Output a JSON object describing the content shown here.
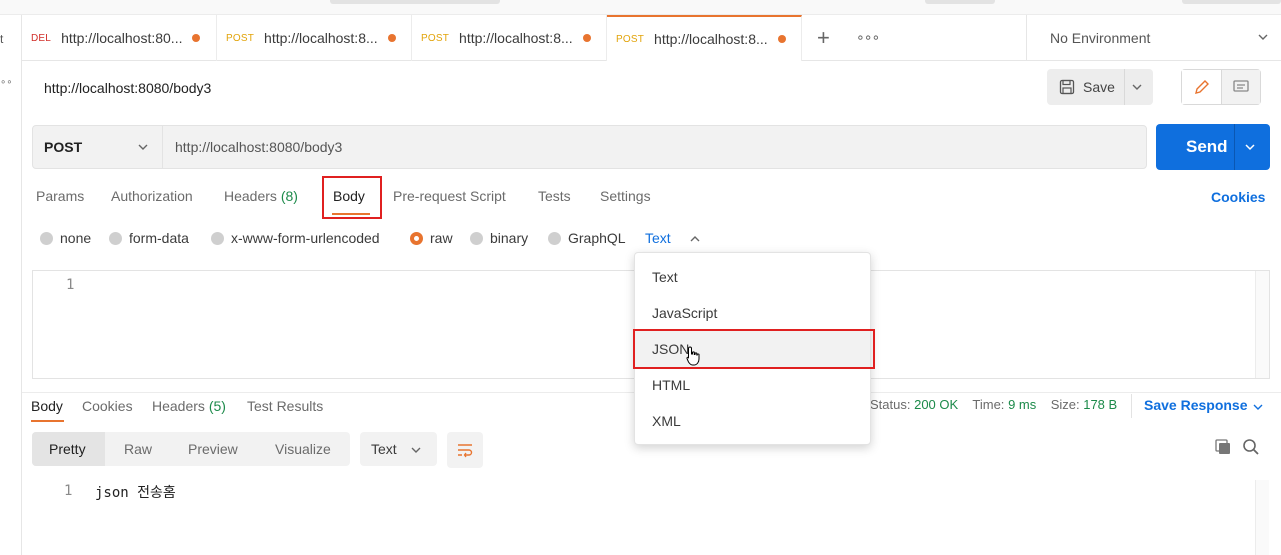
{
  "tabs": [
    {
      "method": "DEL",
      "url": "http://localhost:80..."
    },
    {
      "method": "POST",
      "url": "http://localhost:8..."
    },
    {
      "method": "POST",
      "url": "http://localhost:8..."
    },
    {
      "method": "POST",
      "url": "http://localhost:8..."
    }
  ],
  "environment": "No Environment",
  "request": {
    "name": "http://localhost:8080/body3",
    "save_label": "Save",
    "method": "POST",
    "url": "http://localhost:8080/body3",
    "send_label": "Send"
  },
  "request_tabs": {
    "params": "Params",
    "authorization": "Authorization",
    "headers": "Headers",
    "headers_count": "(8)",
    "body": "Body",
    "prerequest": "Pre-request Script",
    "tests": "Tests",
    "settings": "Settings",
    "cookies": "Cookies"
  },
  "body_types": {
    "none": "none",
    "form_data": "form-data",
    "urlencoded": "x-www-form-urlencoded",
    "raw": "raw",
    "binary": "binary",
    "graphql": "GraphQL",
    "raw_format": "Text"
  },
  "editor": {
    "line1": "1"
  },
  "dropdown": [
    "Text",
    "JavaScript",
    "JSON",
    "HTML",
    "XML"
  ],
  "response": {
    "tabs": {
      "body": "Body",
      "cookies": "Cookies",
      "headers": "Headers",
      "headers_count": "(5)",
      "test_results": "Test Results"
    },
    "status_label": "Status:",
    "status_value": "200 OK",
    "time_label": "Time:",
    "time_value": "9 ms",
    "size_label": "Size:",
    "size_value": "178 B",
    "save_response": "Save Response",
    "formats": {
      "pretty": "Pretty",
      "raw": "Raw",
      "preview": "Preview",
      "visualize": "Visualize"
    },
    "type": "Text",
    "line1": "1",
    "content": "json 전송홈"
  },
  "colors": {
    "accent": "#e8742f",
    "send": "#0f6fde",
    "highlight": "#e02020",
    "success": "#1c8a4a"
  }
}
